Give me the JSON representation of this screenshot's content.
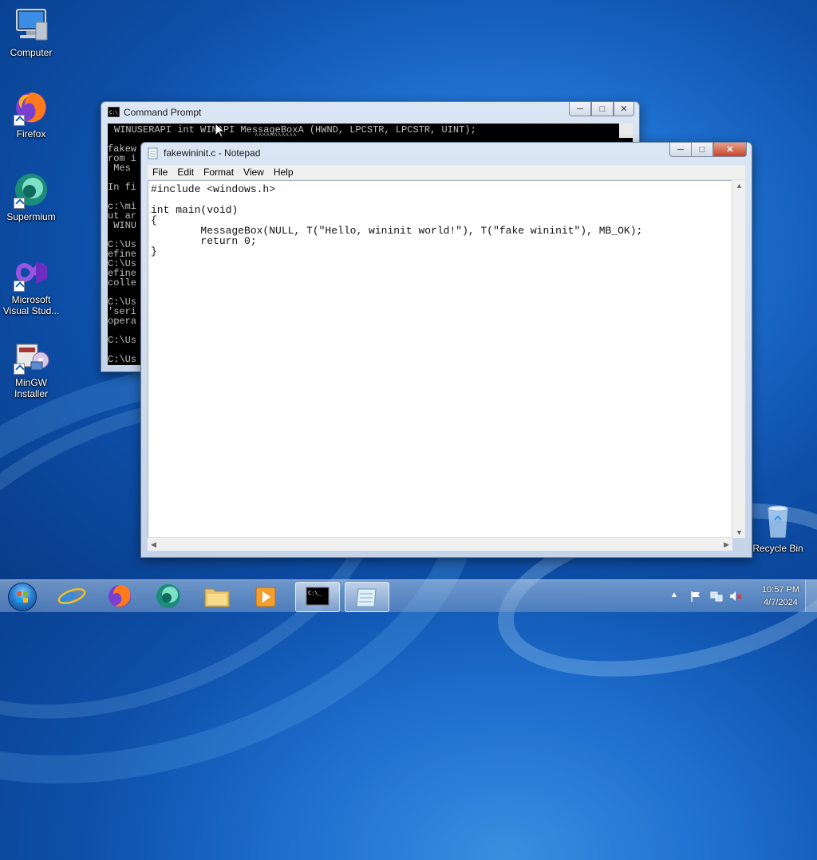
{
  "desktop": {
    "icons": [
      {
        "label": "Computer"
      },
      {
        "label": "Firefox"
      },
      {
        "label": "Supermium"
      },
      {
        "label": "Microsoft Visual Stud..."
      },
      {
        "label": "MinGW Installer"
      },
      {
        "label": "Recycle Bin"
      }
    ]
  },
  "cmd_window": {
    "title": "Command Prompt",
    "header_line": "WINUSERAPI int WINAPI MessageBoxA (HWND, LPCSTR, LPCSTR, UINT);",
    "header_underline": "^^^^^^^^^^^",
    "lines": [
      "fakew",
      "rom i",
      " Mes",
      "",
      "In fi",
      "",
      "c:\\mi",
      "ut ar",
      " WINU",
      "",
      "C:\\Us",
      "efine",
      "C:\\Us",
      "efine",
      "colle",
      "",
      "C:\\Us",
      "'seri",
      "opera",
      "",
      "C:\\Us",
      "",
      "C:\\Us"
    ]
  },
  "notepad": {
    "title": "fakewininit.c - Notepad",
    "menu": [
      "File",
      "Edit",
      "Format",
      "View",
      "Help"
    ],
    "content": "#include <windows.h>\n\nint main(void)\n{\n        MessageBox(NULL, T(\"Hello, wininit world!\"), T(\"fake wininit\"), MB_OK);\n        return 0;\n}"
  },
  "taskbar": {
    "clock_time": "10:57 PM",
    "clock_date": "4/7/2024",
    "colors": {
      "accent": "#1e6fcf"
    }
  }
}
